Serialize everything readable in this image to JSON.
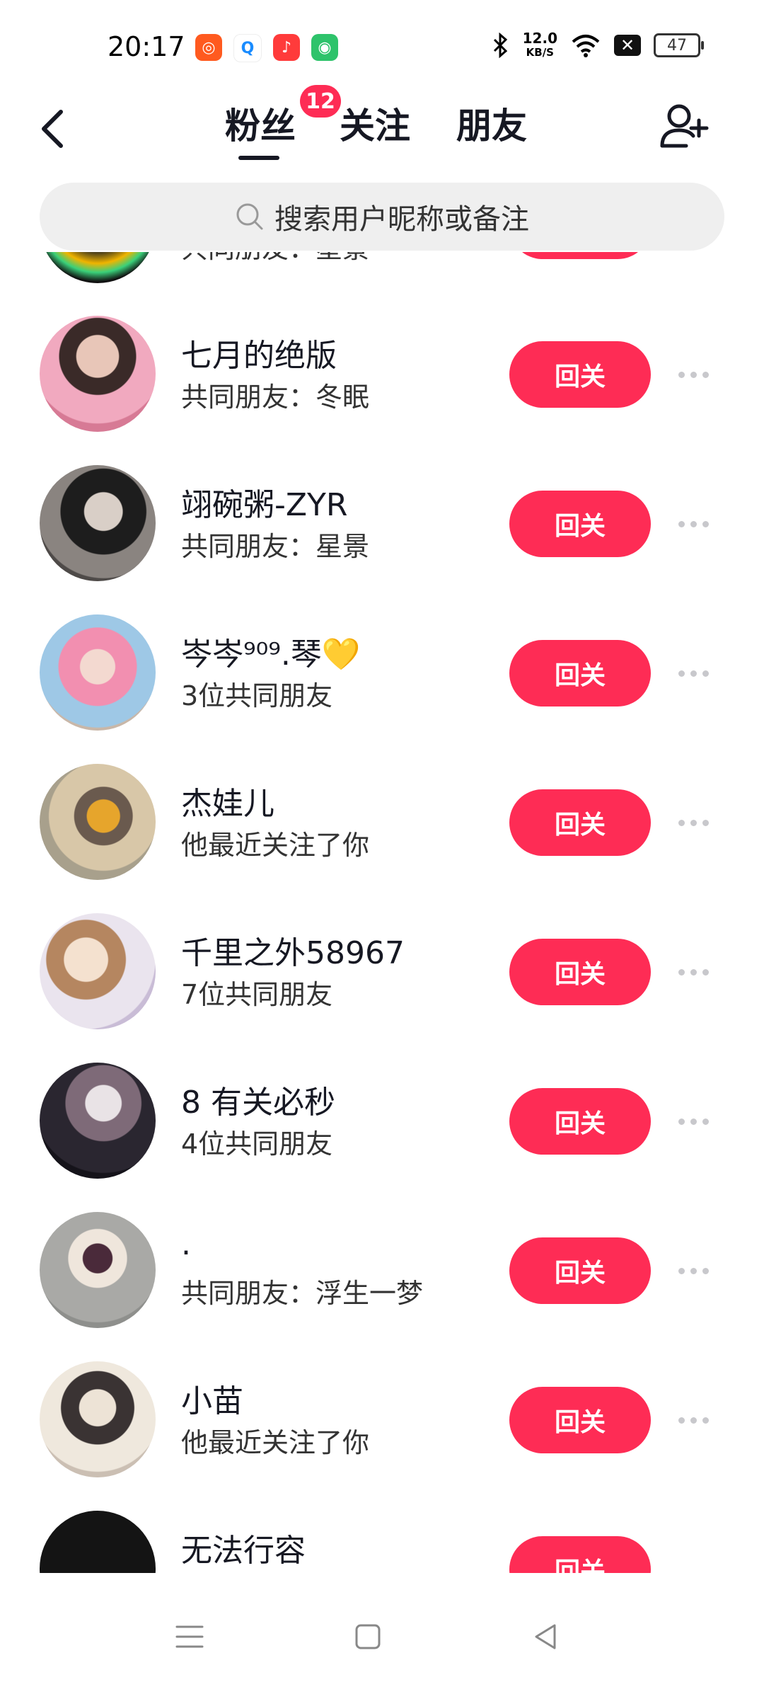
{
  "status_bar": {
    "time": "20:17",
    "speed_value": "12.0",
    "speed_unit": "KB/S",
    "battery": "47",
    "icons": [
      "bluetooth-icon",
      "wifi-icon",
      "x-icon"
    ]
  },
  "header": {
    "tabs": [
      {
        "label": "粉丝",
        "active": true
      },
      {
        "label": "关注",
        "active": false
      },
      {
        "label": "朋友",
        "active": false
      }
    ],
    "badge": "12"
  },
  "search": {
    "placeholder": "搜索用户昵称或备注"
  },
  "list": {
    "follow_label": "回关",
    "rows": [
      {
        "name": "",
        "sub": "共同朋友：星景"
      },
      {
        "name": "七月的绝版",
        "sub": "共同朋友：冬眠"
      },
      {
        "name": "翊碗粥-ZYR",
        "sub": "共同朋友：星景"
      },
      {
        "name": "岑岑⁹⁰⁹.琴💛",
        "sub": "3位共同朋友"
      },
      {
        "name": "杰娃儿",
        "sub": "他最近关注了你"
      },
      {
        "name": "千里之外58967",
        "sub": "7位共同朋友"
      },
      {
        "name": "8 有关必秒",
        "sub": "4位共同朋友"
      },
      {
        "name": ".",
        "sub": "共同朋友：浮生一梦"
      },
      {
        "name": "小苗",
        "sub": "他最近关注了你"
      },
      {
        "name": "无法行容",
        "sub": ""
      }
    ]
  },
  "colors": {
    "accent": "#fe2c55",
    "text": "#161823",
    "search_bg": "#efefef"
  }
}
